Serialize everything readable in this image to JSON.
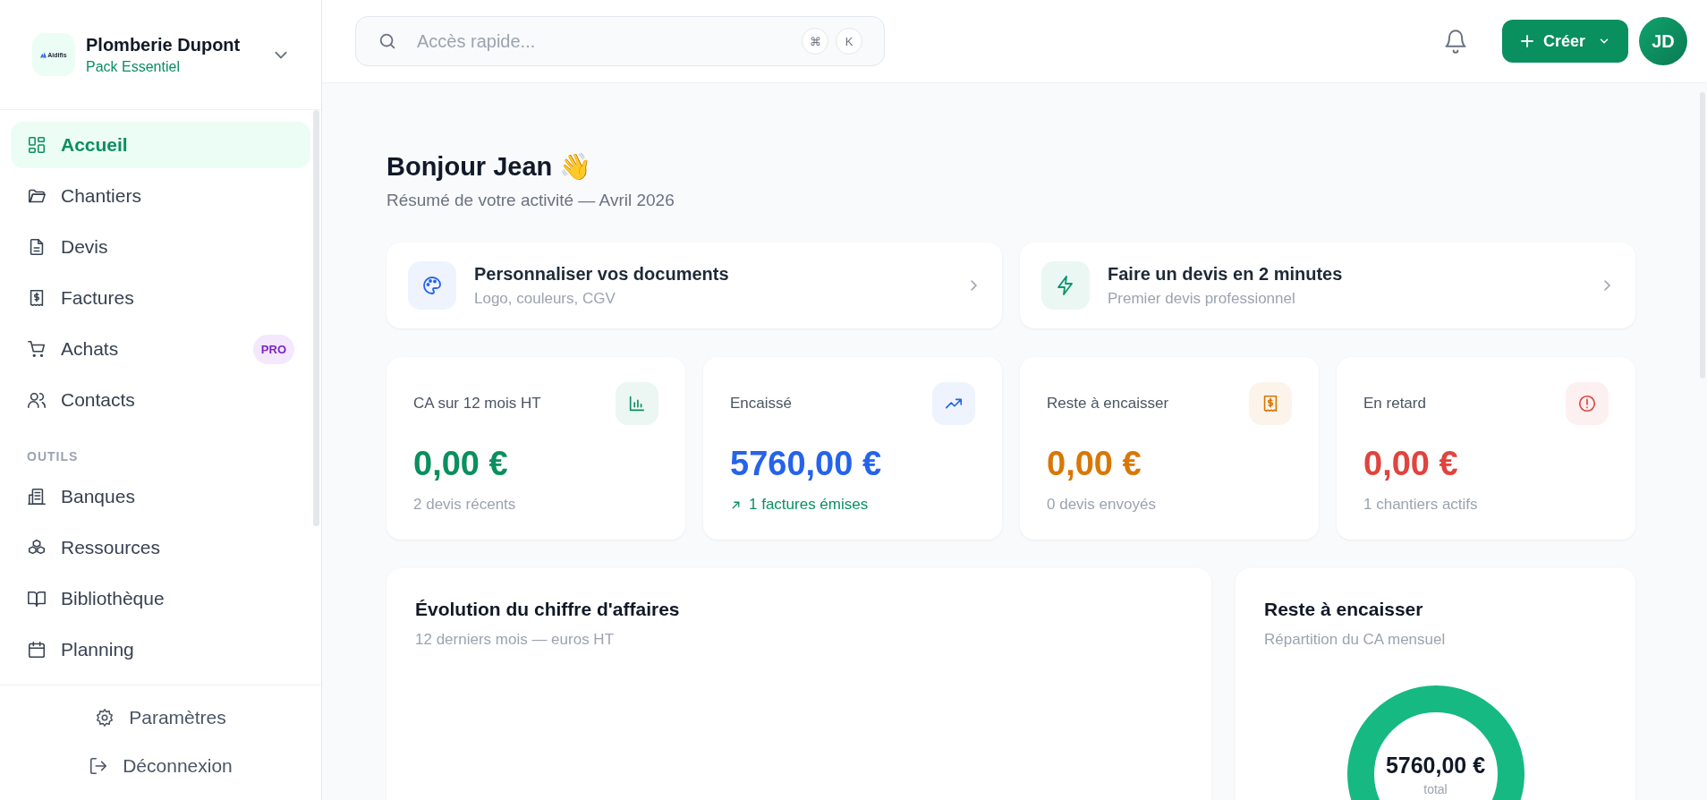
{
  "brand": {
    "logo_text": "Aidifis",
    "name": "Plomberie Dupont",
    "plan": "Pack Essentiel"
  },
  "nav": [
    {
      "label": "Accueil",
      "selected": true
    },
    {
      "label": "Chantiers",
      "selected": false
    },
    {
      "label": "Devis",
      "selected": false
    },
    {
      "label": "Factures",
      "selected": false
    },
    {
      "label": "Achats",
      "selected": false,
      "badge": "PRO"
    },
    {
      "label": "Contacts",
      "selected": false
    }
  ],
  "tools": {
    "heading": "OUTILS",
    "items": [
      {
        "label": "Banques",
        "selected": false
      },
      {
        "label": "Ressources",
        "selected": false
      },
      {
        "label": "Bibliothèque",
        "selected": false
      },
      {
        "label": "Planning",
        "selected": false
      }
    ]
  },
  "footer": [
    "Paramètres",
    "Déconnexion"
  ],
  "search": {
    "placeholder": "Accès rapide...",
    "keys": [
      "⌘",
      "K"
    ]
  },
  "create_button": "Créer",
  "avatar": "JD",
  "greeting": {
    "title": "Bonjour Jean 👋",
    "subtitle": "Résumé de votre activité — Avril 2026"
  },
  "quick_actions": [
    {
      "title": "Personnaliser vos documents",
      "subtitle": "Logo, couleurs, CGV",
      "color": "#2563eb"
    },
    {
      "title": "Faire un devis en 2 minutes",
      "subtitle": "Premier devis professionnel",
      "color": "#059669"
    }
  ],
  "kpis": [
    {
      "label": "CA sur 12 mois HT",
      "value": "0,00 €",
      "note": "2 devis récents",
      "trend": false,
      "color": "#0a8f5f"
    },
    {
      "label": "Encaissé",
      "value": "5760,00 €",
      "note": "1 factures émises",
      "trend": true,
      "color": "#2563eb"
    },
    {
      "label": "Reste à encaisser",
      "value": "0,00 €",
      "note": "0 devis envoyés",
      "trend": false,
      "color": "#d97706"
    },
    {
      "label": "En retard",
      "value": "0,00 €",
      "note": "1 chantiers actifs",
      "trend": false,
      "color": "#e0443e"
    }
  ],
  "revenue_panel": {
    "title": "Évolution du chiffre d'affaires",
    "subtitle": "12 derniers mois — euros HT"
  },
  "balance_panel": {
    "title": "Reste à encaisser",
    "subtitle": "Répartition du CA mensuel",
    "total": "5760,00 €",
    "total_label": "total"
  }
}
